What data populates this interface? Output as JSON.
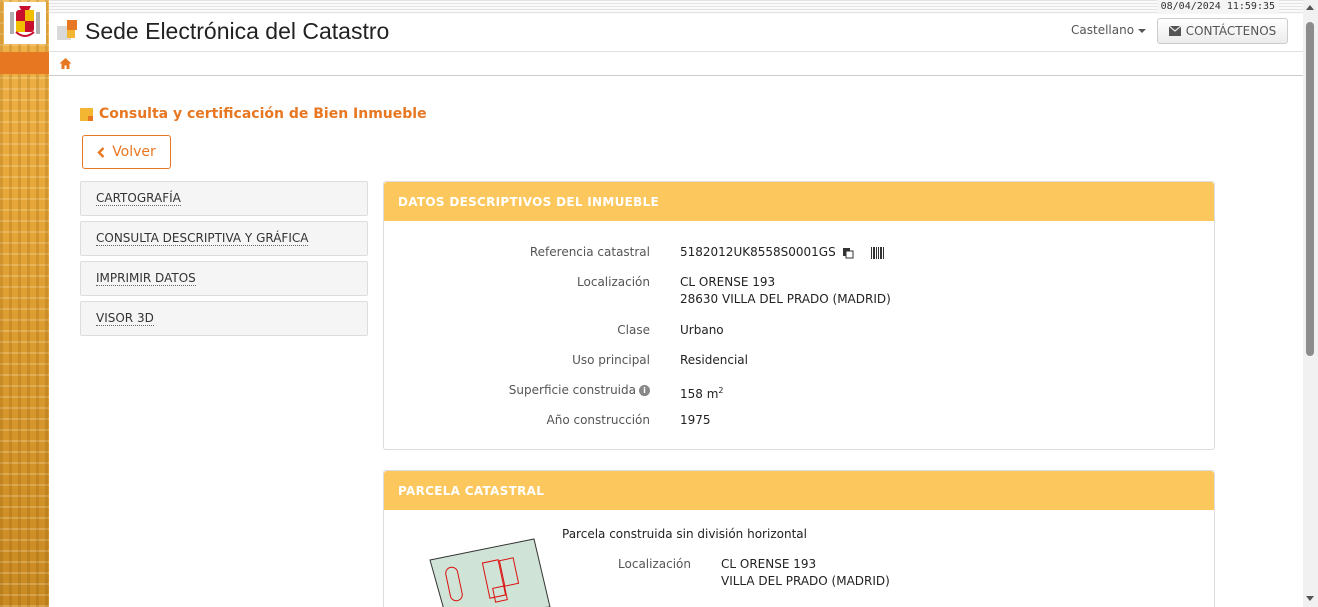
{
  "datetime": "08/04/2024  11:59:35",
  "header": {
    "site_title": "Sede Electrónica del Catastro",
    "language": "Castellano",
    "contact_label": "CONTÁCTENOS"
  },
  "page": {
    "title": "Consulta y certificación de Bien Inmueble",
    "back_label": "Volver"
  },
  "side_menu": {
    "items": [
      {
        "label": "CARTOGRAFÍA"
      },
      {
        "label": "CONSULTA DESCRIPTIVA Y GRÁFICA"
      },
      {
        "label": "IMPRIMIR DATOS"
      },
      {
        "label": "VISOR 3D"
      }
    ]
  },
  "inmueble": {
    "heading": "DATOS DESCRIPTIVOS DEL INMUEBLE",
    "ref_label": "Referencia catastral",
    "ref_value": "5182012UK8558S0001GS",
    "loc_label": "Localización",
    "loc_line1": "CL ORENSE 193",
    "loc_line2": "28630 VILLA DEL PRADO (MADRID)",
    "clase_label": "Clase",
    "clase_value": "Urbano",
    "uso_label": "Uso principal",
    "uso_value": "Residencial",
    "sup_label": "Superficie construida",
    "sup_value": "158 m",
    "sup_unit_sup": "2",
    "anio_label": "Año construcción",
    "anio_value": "1975"
  },
  "parcela": {
    "heading": "PARCELA CATASTRAL",
    "description": "Parcela construida sin división horizontal",
    "loc_label": "Localización",
    "loc_line1": "CL ORENSE 193",
    "loc_line2": "VILLA DEL PRADO (MADRID)"
  },
  "colors": {
    "accent": "#e87722",
    "panel_header": "#fcc75c"
  }
}
